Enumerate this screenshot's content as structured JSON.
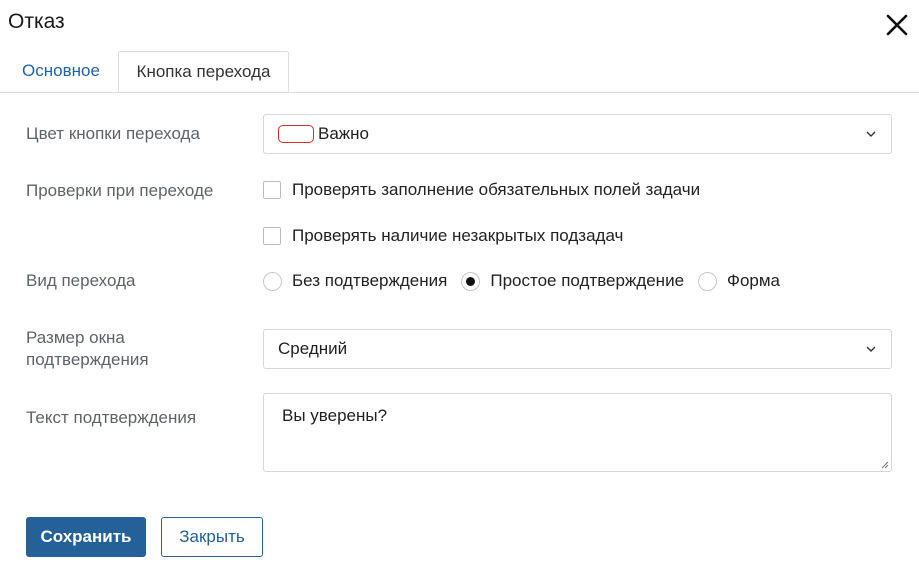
{
  "dialog": {
    "title": "Отказ",
    "close_icon": "close-icon"
  },
  "tabs": [
    {
      "label": "Основное",
      "active": false
    },
    {
      "label": "Кнопка перехода",
      "active": true
    }
  ],
  "form": {
    "button_color": {
      "label": "Цвет кнопки перехода",
      "value": "Важно",
      "swatch_color": "#d32f2f"
    },
    "checks": {
      "label": "Проверки при переходе",
      "options": [
        {
          "label": "Проверять заполнение обязательных полей задачи",
          "checked": false
        },
        {
          "label": "Проверять наличие незакрытых подзадач",
          "checked": false
        }
      ]
    },
    "transition_type": {
      "label": "Вид перехода",
      "options": [
        {
          "label": "Без подтверждения",
          "selected": false
        },
        {
          "label": "Простое подтверждение",
          "selected": true
        },
        {
          "label": "Форма",
          "selected": false
        }
      ]
    },
    "window_size": {
      "label_line1": "Размер окна",
      "label_line2": "подтверждения",
      "value": "Средний"
    },
    "confirm_text": {
      "label": "Текст подтверждения",
      "value": "Вы уверены?"
    }
  },
  "buttons": {
    "save": "Сохранить",
    "close": "Закрыть"
  },
  "colors": {
    "accent": "#246198",
    "tab_link": "#1f63a6",
    "label": "#5f6368",
    "border": "#d7d7d7"
  }
}
